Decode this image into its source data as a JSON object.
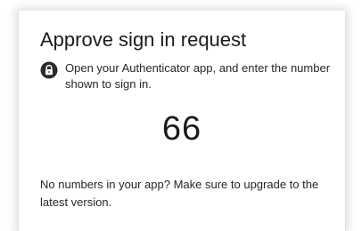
{
  "dialog": {
    "title": "Approve sign in request",
    "instructions": "Open your Authenticator app, and enter the number shown to sign in.",
    "number": "66",
    "footer_text": "No numbers in your app? Make sure to upgrade to the latest version."
  },
  "icons": {
    "instruction_icon": "authenticator-lock-icon"
  },
  "colors": {
    "text": "#1b1b1b",
    "icon": "#2b2b2b"
  }
}
